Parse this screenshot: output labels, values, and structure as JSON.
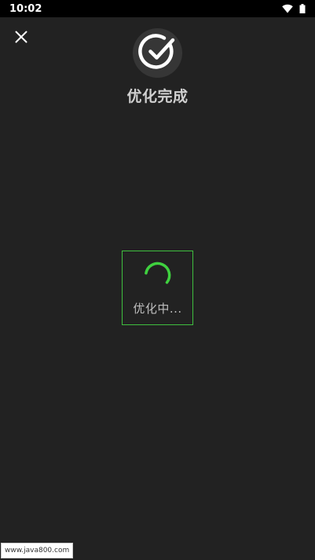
{
  "status_bar": {
    "time": "10:02",
    "icons": [
      "wifi-icon",
      "battery-icon"
    ],
    "text_color": "#ffffff",
    "background": "#000000"
  },
  "header": {
    "close_icon": "close-icon",
    "check_icon": "check-circle-icon",
    "title": "优化完成"
  },
  "loading": {
    "label": "优化中...",
    "spinner_icon": "spinner-icon",
    "accent_color": "#3fd13f"
  },
  "watermark": {
    "text": "www.java800.com"
  },
  "colors": {
    "background": "#222222",
    "title_text": "#d0d0d0",
    "accent": "#3fd13f"
  }
}
